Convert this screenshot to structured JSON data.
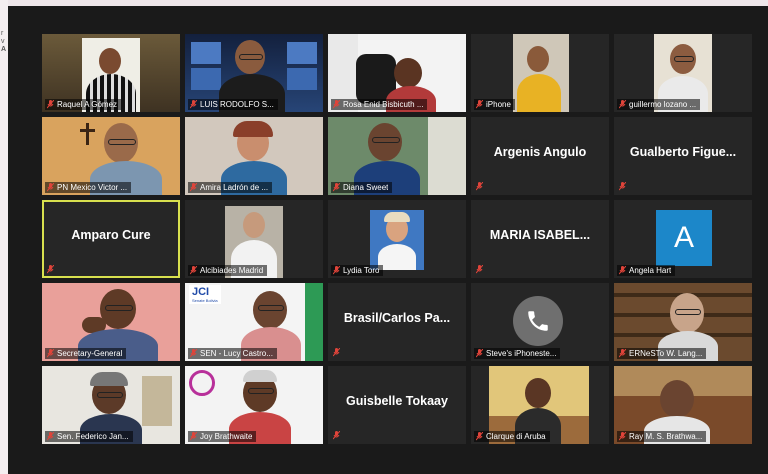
{
  "colors": {
    "active_border": "#d8e04e",
    "avatar_bg": "#1c87c9",
    "muted_mic": "#e0443a",
    "window_bg": "#1a1a1a"
  },
  "participants": [
    {
      "name": "Raquel A Gómez"
    },
    {
      "name": "LUIS RODOLFO S..."
    },
    {
      "name": "Rosa Enid Bisbicuth ..."
    },
    {
      "name": "iPhone"
    },
    {
      "name": "guillermo lozano ..."
    },
    {
      "name": "PN Mexico Victor ..."
    },
    {
      "name": "Amira Ladrón de ..."
    },
    {
      "name": "Diana Sweet"
    },
    {
      "name": "Argenis Angulo"
    },
    {
      "name": "Gualberto Figue..."
    },
    {
      "name": "Amparo Cure"
    },
    {
      "name": "Alcibiades Madrid"
    },
    {
      "name": "Lydia Toro"
    },
    {
      "name": "MARIA ISABEL..."
    },
    {
      "name": "Angela Hart",
      "avatar_letter": "A"
    },
    {
      "name": "Secretary-General"
    },
    {
      "name": "SEN - Lucy Castro..."
    },
    {
      "name": "Brasil/Carlos Pa..."
    },
    {
      "name": "Steve's iPhoneste..."
    },
    {
      "name": "ERNeSTo W. Lang..."
    },
    {
      "name": "Sen. Federico Jan..."
    },
    {
      "name": "Joy Brathwaite"
    },
    {
      "name": "Guisbelle Tokaay"
    },
    {
      "name": "Clarque di Aruba"
    },
    {
      "name": "Ray M. S. Brathwa..."
    }
  ],
  "logos": {
    "jci_text": "JCI",
    "jci_sub": "Senate Bolivia"
  },
  "desktop": {
    "marks": [
      "r",
      "v",
      "A"
    ]
  }
}
